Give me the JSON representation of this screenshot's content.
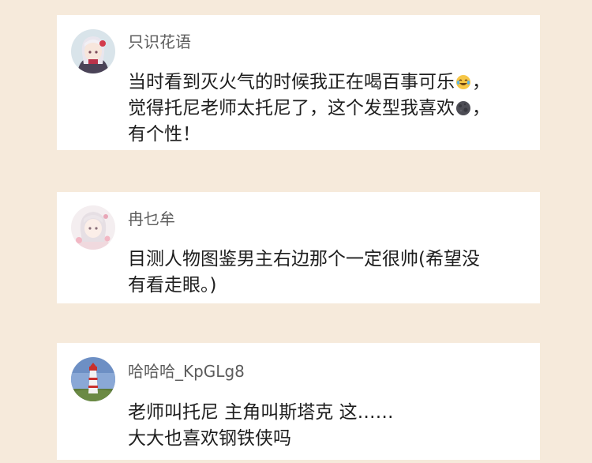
{
  "comments": [
    {
      "username": "只识花语",
      "avatar_icon": "anime-girl-avatar-icon",
      "lines": [
        {
          "before": "当时看到灭火气的时候我正在喝百事可乐",
          "emoji": "laughing-tears-emoji",
          "after": "，"
        },
        {
          "before": "觉得托尼老师太托尼了，这个发型我喜欢",
          "emoji": "moon-face-emoji",
          "after": "，"
        },
        {
          "before": "有个性！"
        }
      ]
    },
    {
      "username": "冉乜牟",
      "avatar_icon": "anime-girl-avatar-icon",
      "lines": [
        {
          "before": "目测人物图鉴男主右边那个一定很帅(希望没"
        },
        {
          "before": "有看走眼。)"
        }
      ]
    },
    {
      "username": "哈哈哈_KpGLg8",
      "avatar_icon": "lighthouse-avatar-icon",
      "lines": [
        {
          "before": "老师叫托尼 主角叫斯塔克 这……"
        },
        {
          "before": "大大也喜欢钢铁侠吗"
        }
      ]
    }
  ],
  "colors": {
    "background": "#f6eadb",
    "card": "#ffffff",
    "username": "#5c5c5c",
    "comment_text": "#1e1e1e"
  }
}
